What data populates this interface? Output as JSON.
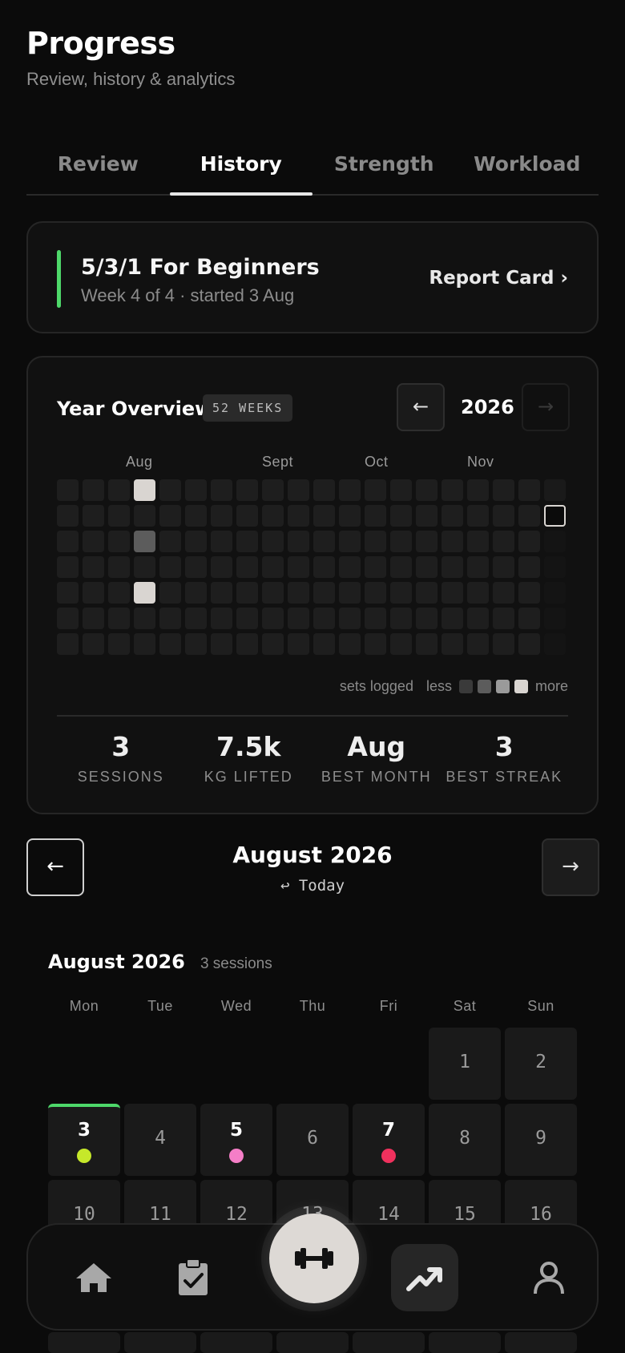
{
  "header": {
    "title": "Progress",
    "subtitle": "Review, history & analytics"
  },
  "tabs": [
    {
      "label": "Review",
      "active": false
    },
    {
      "label": "History",
      "active": true
    },
    {
      "label": "Strength",
      "active": false
    },
    {
      "label": "Workload",
      "active": false
    }
  ],
  "program": {
    "name": "5/3/1 For Beginners",
    "meta": "Week 4 of 4 · started 3 Aug",
    "report_label": "Report Card ›",
    "accent": "#4ed86a"
  },
  "year_overview": {
    "title": "Year Overview",
    "weeks_badge": "52 WEEKS",
    "year": "2026",
    "prev_arrow": "←",
    "next_arrow": "→",
    "months": [
      "Aug",
      "Sept",
      "Oct",
      "Nov"
    ],
    "legend": {
      "label": "sets logged",
      "less": "less",
      "more": "more",
      "levels": [
        "#3a3a3a",
        "#5c5c5c",
        "#9a9a9a",
        "#d9d5d1"
      ]
    },
    "highlighted": [
      {
        "week": 3,
        "day": 0,
        "level": 4
      },
      {
        "week": 3,
        "day": 2,
        "level": 2
      },
      {
        "week": 3,
        "day": 4,
        "level": 4
      }
    ],
    "today_cell": {
      "week": 19,
      "day": 1
    },
    "stats": [
      {
        "value": "3",
        "label": "SESSIONS"
      },
      {
        "value": "7.5k",
        "label": "KG LIFTED"
      },
      {
        "value": "Aug",
        "label": "BEST MONTH"
      },
      {
        "value": "3",
        "label": "BEST STREAK"
      }
    ]
  },
  "month_nav": {
    "title": "August 2026",
    "today": "↩ Today",
    "prev_arrow": "←",
    "next_arrow": "→"
  },
  "calendar": {
    "title": "August 2026",
    "sessions": "3 sessions",
    "weekdays": [
      "Mon",
      "Tue",
      "Wed",
      "Thu",
      "Fri",
      "Sat",
      "Sun"
    ],
    "days": [
      {
        "n": "1"
      },
      {
        "n": "2"
      },
      {
        "n": "3",
        "dot": "#c6e82a",
        "current_week": true
      },
      {
        "n": "4"
      },
      {
        "n": "5",
        "dot": "#f57ec7"
      },
      {
        "n": "6"
      },
      {
        "n": "7",
        "dot": "#f0315d"
      },
      {
        "n": "8"
      },
      {
        "n": "9"
      },
      {
        "n": "10"
      },
      {
        "n": "11"
      },
      {
        "n": "12"
      },
      {
        "n": "13"
      },
      {
        "n": "14"
      },
      {
        "n": "15"
      },
      {
        "n": "16"
      }
    ]
  },
  "bottom_nav": {
    "items": [
      {
        "name": "home-icon"
      },
      {
        "name": "clipboard-check-icon"
      },
      {
        "name": "dumbbell-icon",
        "primary": true
      },
      {
        "name": "trending-up-icon",
        "active": true
      },
      {
        "name": "person-icon"
      }
    ]
  }
}
